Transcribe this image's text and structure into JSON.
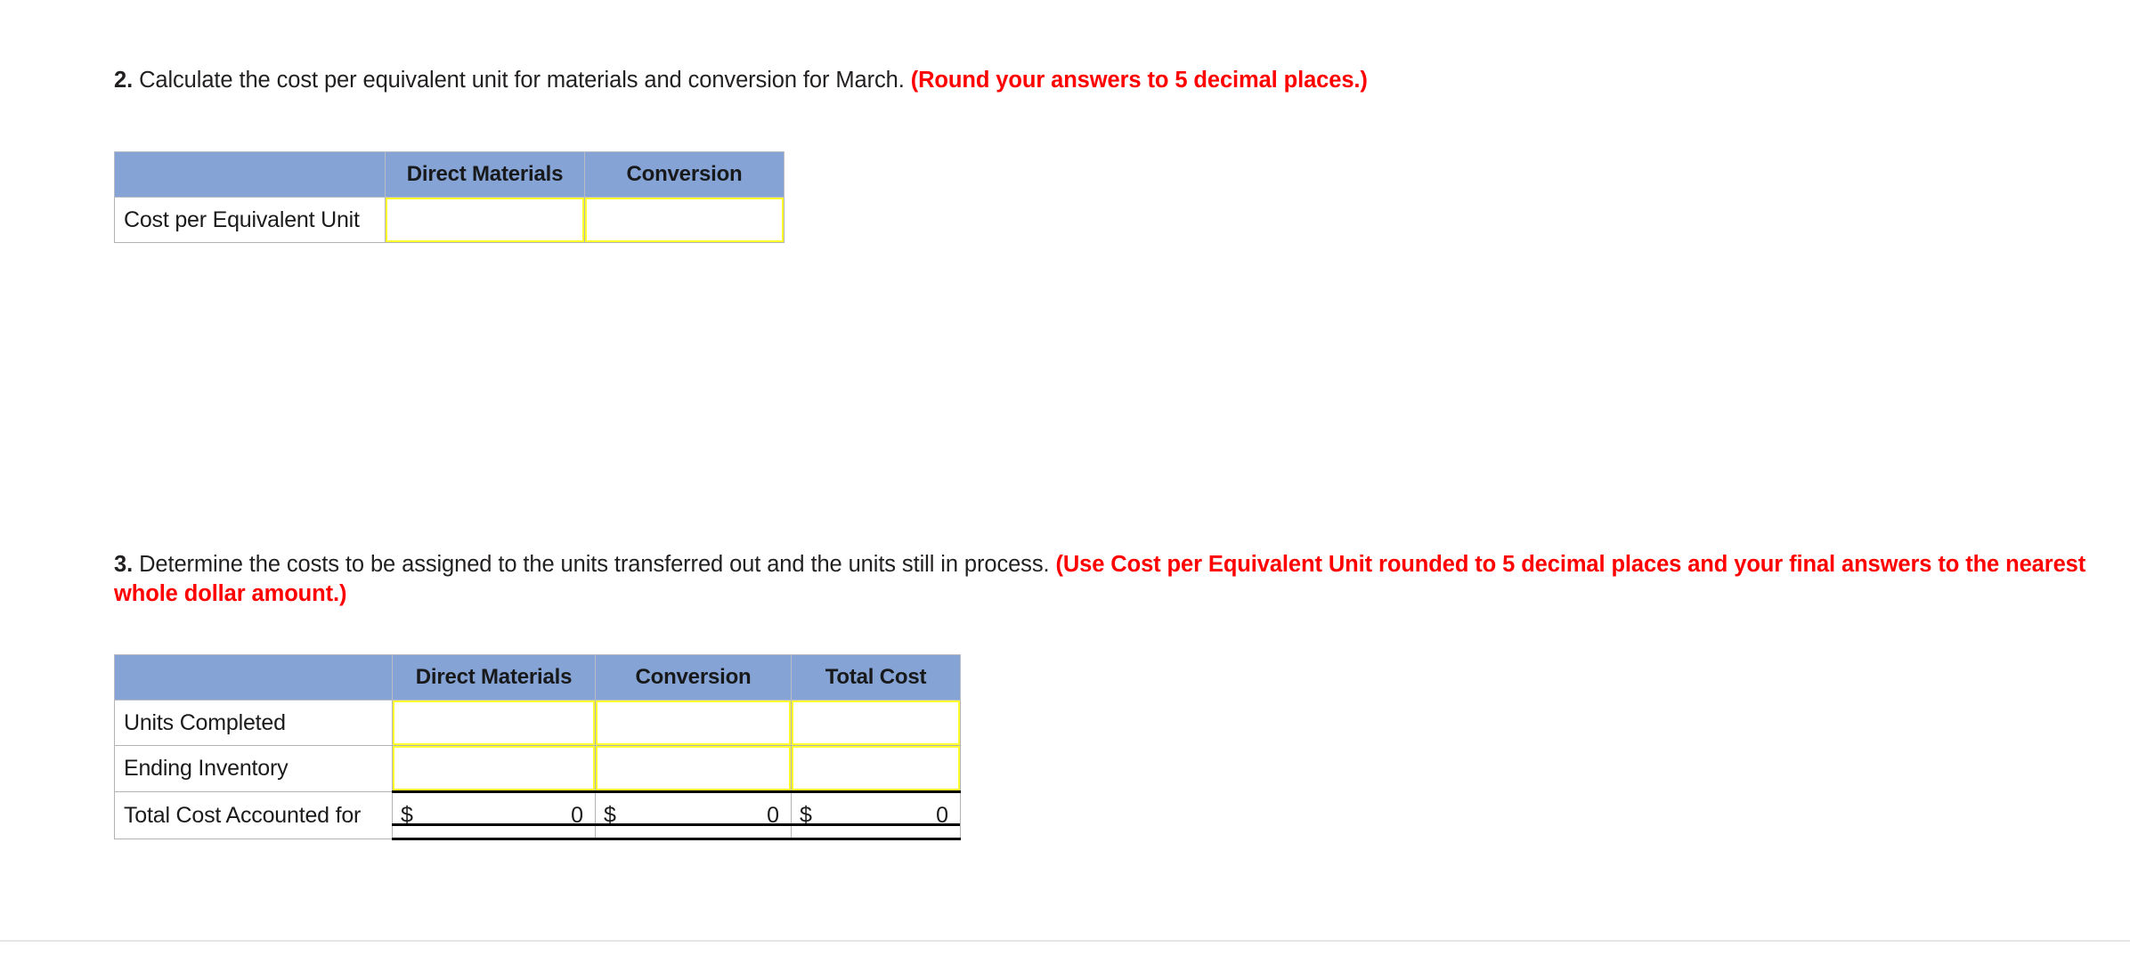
{
  "question_2": {
    "number": "2.",
    "text": " Calculate the cost per equivalent unit for materials and conversion for March. ",
    "note": "(Round your answers to 5 decimal places.)"
  },
  "question_3": {
    "number": "3.",
    "text": " Determine the costs to be assigned to the units transferred out and the units still in process. ",
    "note": "(Use Cost per Equivalent Unit rounded to 5 decimal places and your final answers to the nearest whole dollar amount.)"
  },
  "table_1": {
    "headers": [
      "",
      "Direct Materials",
      "Conversion"
    ],
    "rows": [
      {
        "label": "Cost per Equivalent Unit",
        "cells": [
          "",
          ""
        ]
      }
    ]
  },
  "table_2": {
    "headers": [
      "",
      "Direct Materials",
      "Conversion",
      "Total Cost"
    ],
    "rows": [
      {
        "label": "Units Completed",
        "cells": [
          "",
          "",
          ""
        ]
      },
      {
        "label": "Ending Inventory",
        "cells": [
          "",
          "",
          ""
        ]
      }
    ],
    "total_row": {
      "label": "Total Cost Accounted for",
      "currency_symbol": "$",
      "values": [
        "0",
        "0",
        "0"
      ]
    }
  },
  "colors": {
    "header_blue": "#85a3d4",
    "note_red": "#fe0000",
    "input_yellow": "#ffff2e",
    "grid_gray": "#b3b3b3"
  }
}
